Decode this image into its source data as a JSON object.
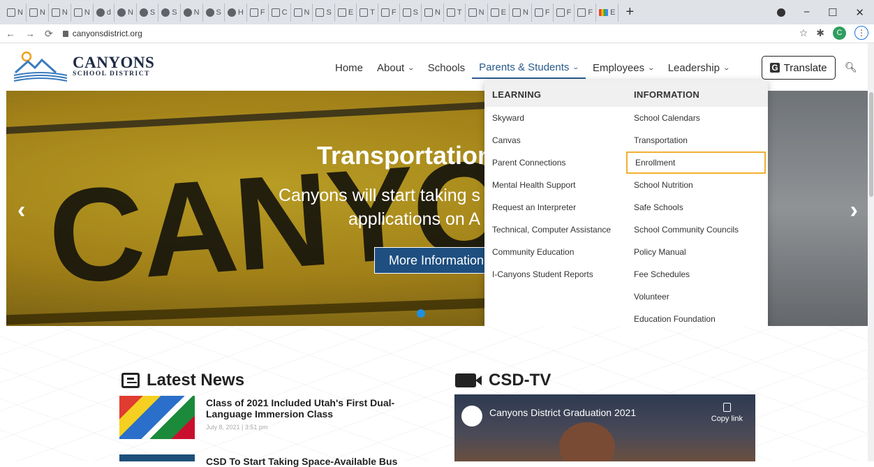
{
  "browser": {
    "tabs": [
      "N",
      "N",
      "N",
      "N",
      "d",
      "N",
      "S",
      "S",
      "N",
      "S",
      "H",
      "F",
      "C",
      "N",
      "S",
      "E",
      "T",
      "F",
      "S",
      "N",
      "T",
      "N",
      "E",
      "N",
      "F",
      "F",
      "F",
      "E"
    ],
    "active_tab_label": "H",
    "url": "canyonsdistrict.org",
    "profile_initial": "C",
    "new_tab": "+",
    "controls": {
      "minimize": "−",
      "maximize": "☐",
      "close": "✕"
    }
  },
  "site": {
    "logo_line1": "CANYONS",
    "logo_line2": "SCHOOL DISTRICT",
    "nav": [
      {
        "label": "Home"
      },
      {
        "label": "About"
      },
      {
        "label": "Schools"
      },
      {
        "label": "Parents & Students"
      },
      {
        "label": "Employees"
      },
      {
        "label": "Leadership"
      }
    ],
    "translate_label": "Translate"
  },
  "hero": {
    "title": "Transportation",
    "subtitle_line1": "Canyons will start taking s",
    "subtitle_line2": "applications on A",
    "button_label": "More Information",
    "background_text": "CANYONS"
  },
  "dropdown": {
    "learning_header": "LEARNING",
    "information_header": "INFORMATION",
    "learning": [
      "Skyward",
      "Canvas",
      "Parent Connections",
      "Mental Health Support",
      "Request an Interpreter",
      "Technical, Computer Assistance",
      "Community Education",
      "I-Canyons Student Reports"
    ],
    "information": [
      "School Calendars",
      "Transportation",
      "Enrollment",
      "School Nutrition",
      "Safe Schools",
      "School Community Councils",
      "Policy Manual",
      "Fee Schedules",
      "Volunteer",
      "Education Foundation"
    ]
  },
  "news": {
    "section_title": "Latest News",
    "items": [
      {
        "title": "Class of 2021 Included Utah's First Dual-Language Immersion Class",
        "date": "July 8, 2021",
        "time": "3:51 pm"
      },
      {
        "title": "CSD To Start Taking Space-Available Bus"
      }
    ]
  },
  "tv": {
    "section_title": "CSD-TV",
    "video_title": "Canyons District Graduation 2021",
    "copy_label": "Copy link"
  },
  "colors": {
    "accent": "#2a5b8c",
    "highlight": "#f0b030",
    "button": "#1e4f80"
  }
}
